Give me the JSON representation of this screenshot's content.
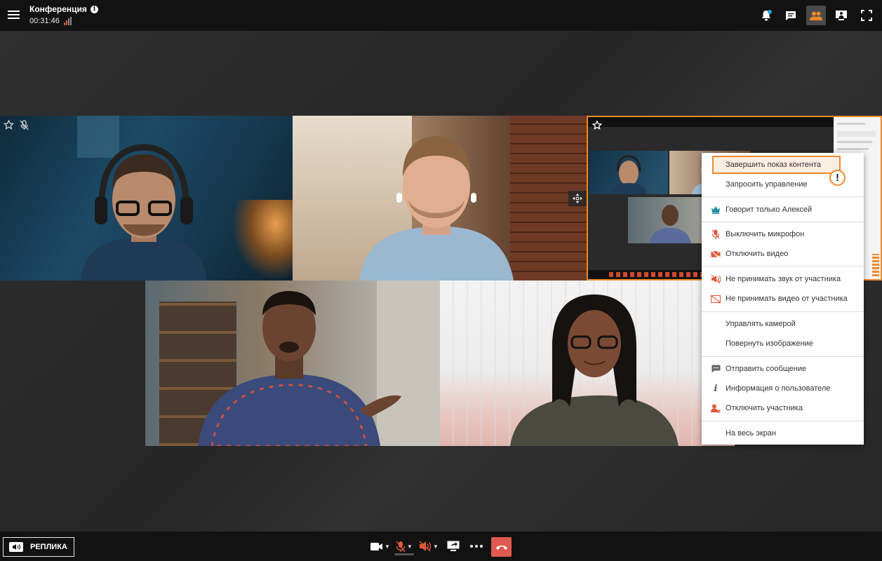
{
  "header": {
    "conference_title": "Конференция",
    "elapsed_time": "00:31:46"
  },
  "toolbar_top": {
    "icons": [
      "bell-icon",
      "chat-icon",
      "participants-icon",
      "layout-icon",
      "fullscreen-icon"
    ],
    "active": "participants-icon",
    "notification_color": "#2aa7d6"
  },
  "context_menu": {
    "items": [
      {
        "label": "Завершить показ контента",
        "icon": "",
        "highlighted": true
      },
      {
        "label": "Запросить управление",
        "icon": ""
      },
      {
        "label": "Говорит только Алексей",
        "icon": "crown-icon"
      },
      {
        "label": "Выключить микрофон",
        "icon": "mic-off-icon"
      },
      {
        "label": "Отключить видео",
        "icon": "video-off-icon"
      },
      {
        "label": "Не принимать звук от участника",
        "icon": "speaker-off-icon"
      },
      {
        "label": "Не принимать видео от участника",
        "icon": "video-block-icon"
      },
      {
        "label": "Управлять камерой",
        "icon": ""
      },
      {
        "label": "Повернуть изображение",
        "icon": ""
      },
      {
        "label": "Отправить сообщение",
        "icon": "message-icon"
      },
      {
        "label": "Информация о пользователе",
        "icon": "info-icon"
      },
      {
        "label": "Отключить участника",
        "icon": "remove-user-icon"
      },
      {
        "label": "На весь экран",
        "icon": ""
      }
    ],
    "warning_symbol": "!"
  },
  "bottom_bar": {
    "replica_label": "РЕПЛИКА",
    "controls": [
      "camera-icon",
      "mic-muted-icon",
      "speaker-muted-icon",
      "share-screen-icon",
      "more-icon",
      "hangup-icon"
    ]
  },
  "colors": {
    "accent": "#f08a2a",
    "muted_red": "#e05a3a",
    "hangup": "#e05a4f",
    "crown": "#1f8fa0"
  }
}
